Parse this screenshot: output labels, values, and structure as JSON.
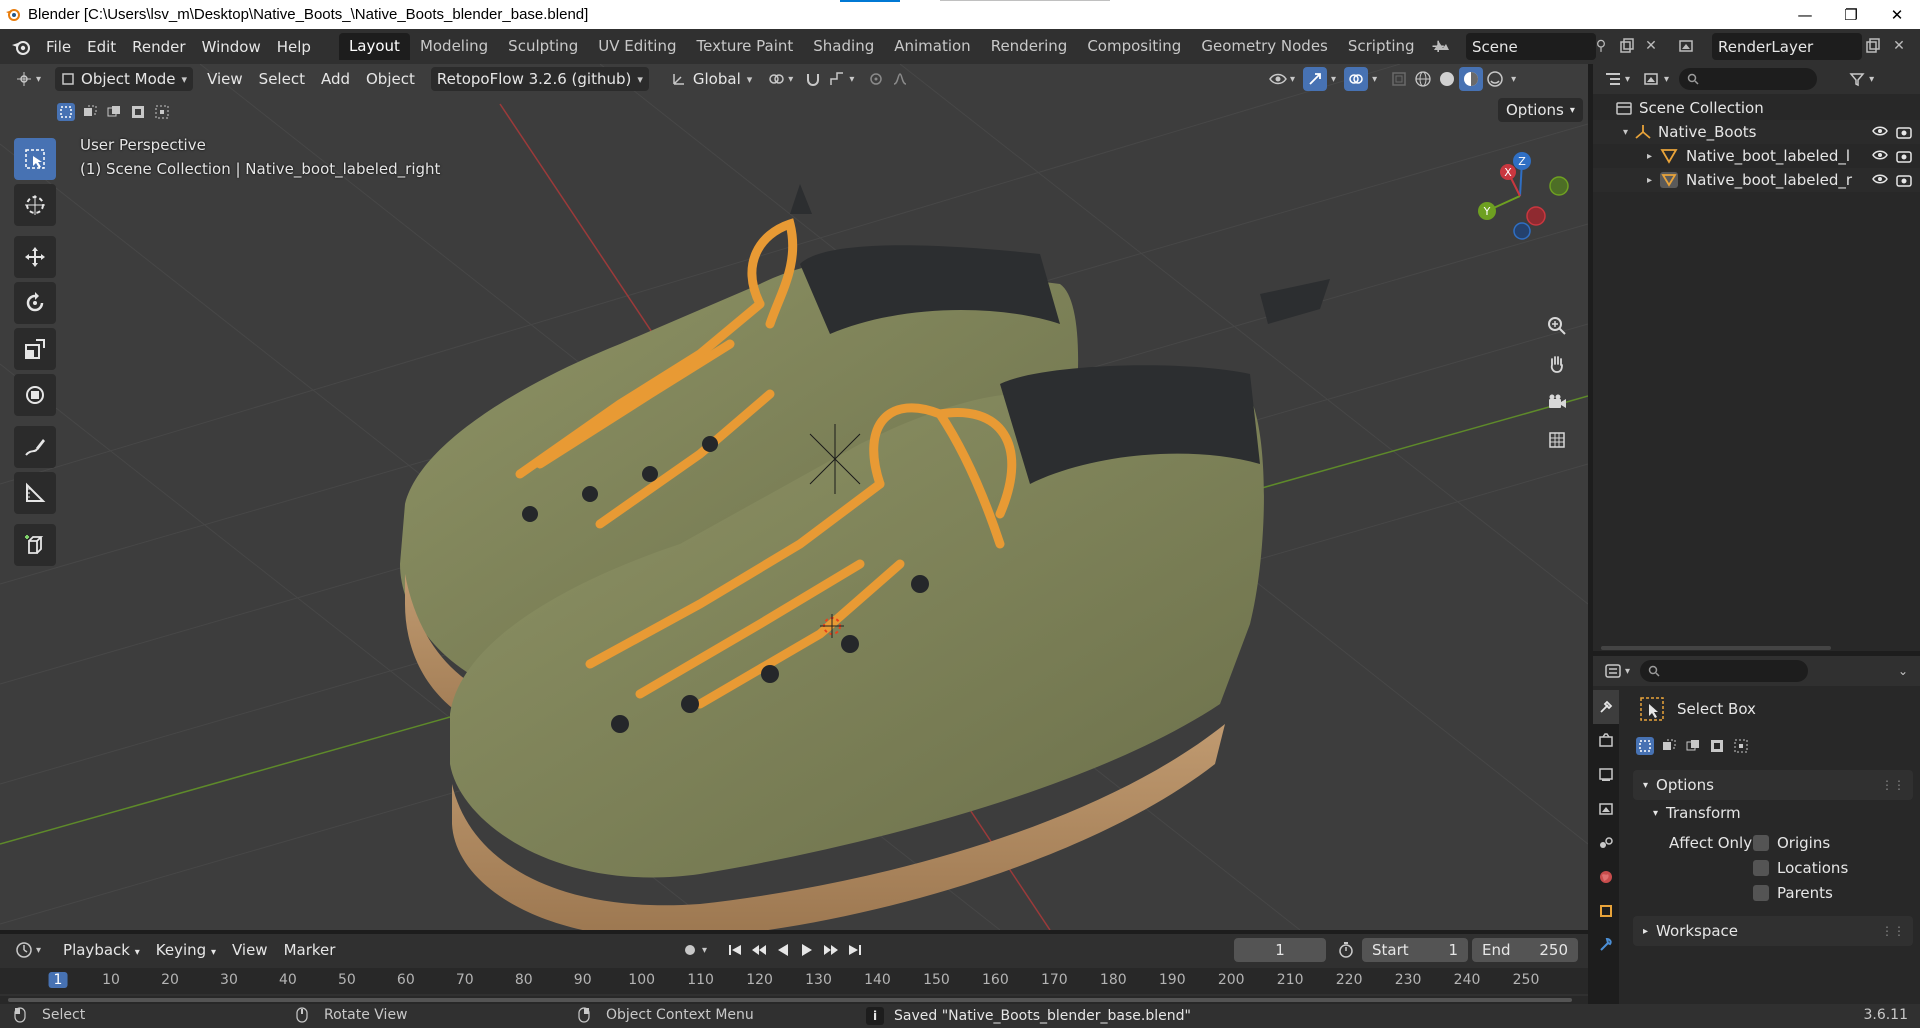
{
  "window": {
    "title": "Blender [C:\\Users\\lsv_m\\Desktop\\Native_Boots_\\Native_Boots_blender_base.blend]",
    "controls": [
      "—",
      "❐",
      "✕"
    ]
  },
  "menu": [
    "File",
    "Edit",
    "Render",
    "Window",
    "Help"
  ],
  "workspaces": {
    "tabs": [
      "Layout",
      "Modeling",
      "Sculpting",
      "UV Editing",
      "Texture Paint",
      "Shading",
      "Animation",
      "Rendering",
      "Compositing",
      "Geometry Nodes",
      "Scripting"
    ],
    "active": "Layout",
    "add": "+"
  },
  "scene": {
    "name": "Scene",
    "view_layer": "RenderLayer"
  },
  "viewport_header": {
    "mode": "Object Mode",
    "menus": [
      "View",
      "Select",
      "Add",
      "Object"
    ],
    "addon": "RetopoFlow 3.2.6 (github)",
    "orientation": "Global",
    "options_label": "Options"
  },
  "viewport": {
    "perspective": "User Perspective",
    "collection_info": "(1) Scene Collection | Native_boot_labeled_right",
    "axes": {
      "x": "X",
      "y": "Y",
      "z": "Z"
    },
    "colors": {
      "bg": "#3d3d3d",
      "grid": "#474747",
      "x_axis": "#9b3a3a",
      "y_axis": "#5e8a2a",
      "boot_upper": "#7c8058",
      "sole": "#b08a62",
      "lace": "#e89a34",
      "collar": "#2c2e30"
    }
  },
  "outliner": {
    "root": "Scene Collection",
    "items": [
      {
        "label": "Native_Boots",
        "level": 1
      },
      {
        "label": "Native_boot_labeled_l",
        "level": 2
      },
      {
        "label": "Native_boot_labeled_r",
        "level": 2
      }
    ]
  },
  "properties": {
    "tool_name": "Select Box",
    "options_label": "Options",
    "transform_label": "Transform",
    "affect_only_label": "Affect Only",
    "affect_options": [
      "Origins",
      "Locations",
      "Parents"
    ],
    "workspace_label": "Workspace"
  },
  "timeline": {
    "menus": [
      "Playback",
      "Keying",
      "View",
      "Marker"
    ],
    "current_frame": "1",
    "start_label": "Start",
    "start_value": "1",
    "end_label": "End",
    "end_value": "250",
    "ruler": [
      "1",
      "10",
      "20",
      "30",
      "40",
      "50",
      "60",
      "70",
      "80",
      "90",
      "100",
      "110",
      "120",
      "130",
      "140",
      "150",
      "160",
      "170",
      "180",
      "190",
      "200",
      "210",
      "220",
      "230",
      "240",
      "250"
    ]
  },
  "statusbar": {
    "select": "Select",
    "rotate": "Rotate View",
    "context": "Object Context Menu",
    "saved": "Saved \"Native_Boots_blender_base.blend\"",
    "version": "3.6.11"
  }
}
